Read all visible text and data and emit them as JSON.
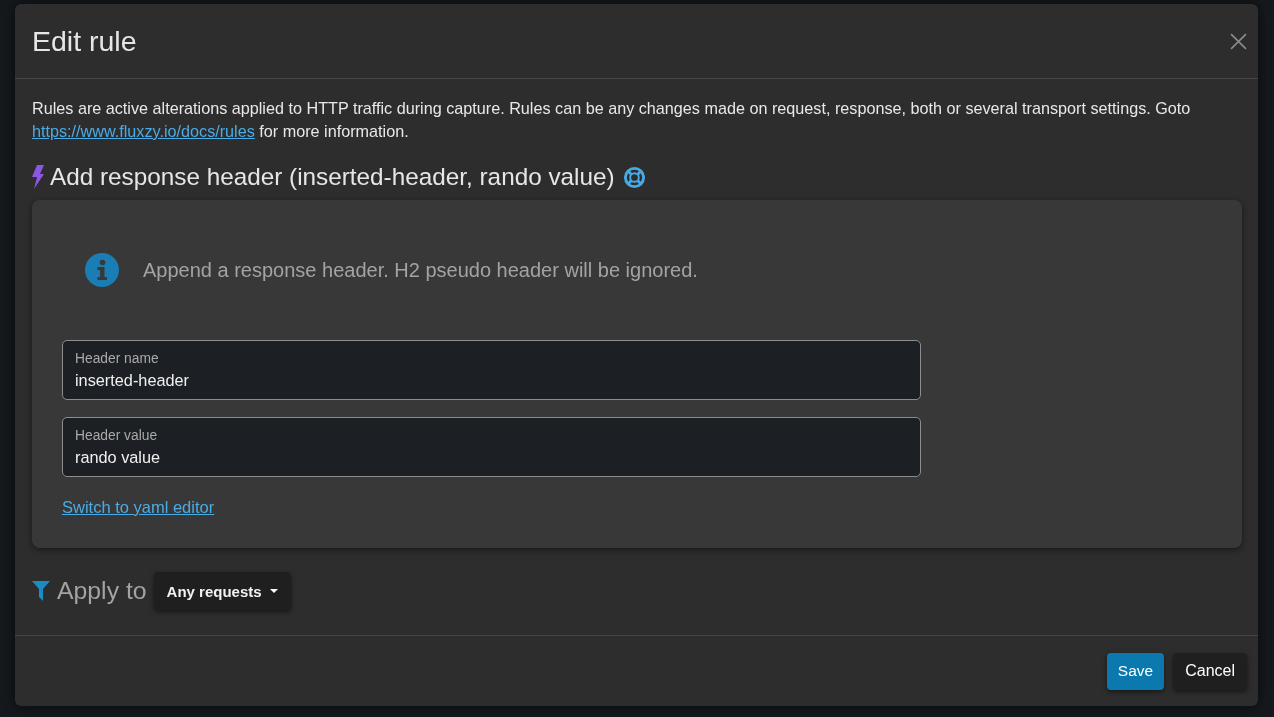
{
  "dialog": {
    "title": "Edit rule"
  },
  "description": {
    "text": "Rules are active alterations applied to HTTP traffic during capture. Rules can be any changes made on request, response, both or several transport settings. Goto",
    "link": "https://www.fluxzy.io/docs/rules",
    "after": "for more information."
  },
  "action": {
    "title": "Add response header (inserted-header, rando value)"
  },
  "card": {
    "info": "Append a response header. H2 pseudo header will be ignored.",
    "fields": [
      {
        "label": "Header name",
        "value": "inserted-header"
      },
      {
        "label": "Header value",
        "value": "rando value"
      }
    ],
    "yaml_link": "Switch to yaml editor"
  },
  "filter": {
    "label": "Apply to",
    "selection": "Any requests"
  },
  "buttons": [
    {
      "label": "Save",
      "kind": "primary"
    },
    {
      "label": "Cancel",
      "kind": "secondary"
    }
  ]
}
